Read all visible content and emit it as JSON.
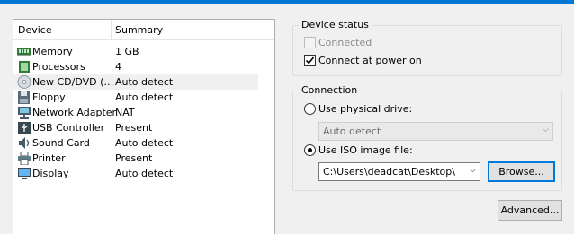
{
  "device_list": {
    "headers": {
      "device": "Device",
      "summary": "Summary"
    },
    "rows": [
      {
        "icon": "memory-icon",
        "name": "Memory",
        "summary": "1 GB",
        "selected": false
      },
      {
        "icon": "processor-icon",
        "name": "Processors",
        "summary": "4",
        "selected": false
      },
      {
        "icon": "cd-dvd-icon",
        "name": "New CD/DVD (…",
        "summary": "Auto detect",
        "selected": true
      },
      {
        "icon": "floppy-icon",
        "name": "Floppy",
        "summary": "Auto detect",
        "selected": false
      },
      {
        "icon": "network-adapter-icon",
        "name": "Network Adapter",
        "summary": "NAT",
        "selected": false
      },
      {
        "icon": "usb-icon",
        "name": "USB Controller",
        "summary": "Present",
        "selected": false
      },
      {
        "icon": "sound-icon",
        "name": "Sound Card",
        "summary": "Auto detect",
        "selected": false
      },
      {
        "icon": "printer-icon",
        "name": "Printer",
        "summary": "Present",
        "selected": false
      },
      {
        "icon": "display-icon",
        "name": "Display",
        "summary": "Auto detect",
        "selected": false
      }
    ]
  },
  "device_status": {
    "title": "Device status",
    "connected_label": "Connected",
    "connected_checked": false,
    "connect_power_label": "Connect at power on",
    "connect_power_checked": true
  },
  "connection": {
    "title": "Connection",
    "physical_label": "Use physical drive:",
    "physical_value": "Auto detect",
    "iso_label": "Use ISO image file:",
    "iso_value": "C:\\Users\\deadcat\\Desktop\\",
    "browse_label": "Browse...",
    "selected_option": "iso"
  },
  "advanced_label": "Advanced...",
  "colors": {
    "accent": "#0078d7",
    "selection": "#f0f0f0"
  }
}
